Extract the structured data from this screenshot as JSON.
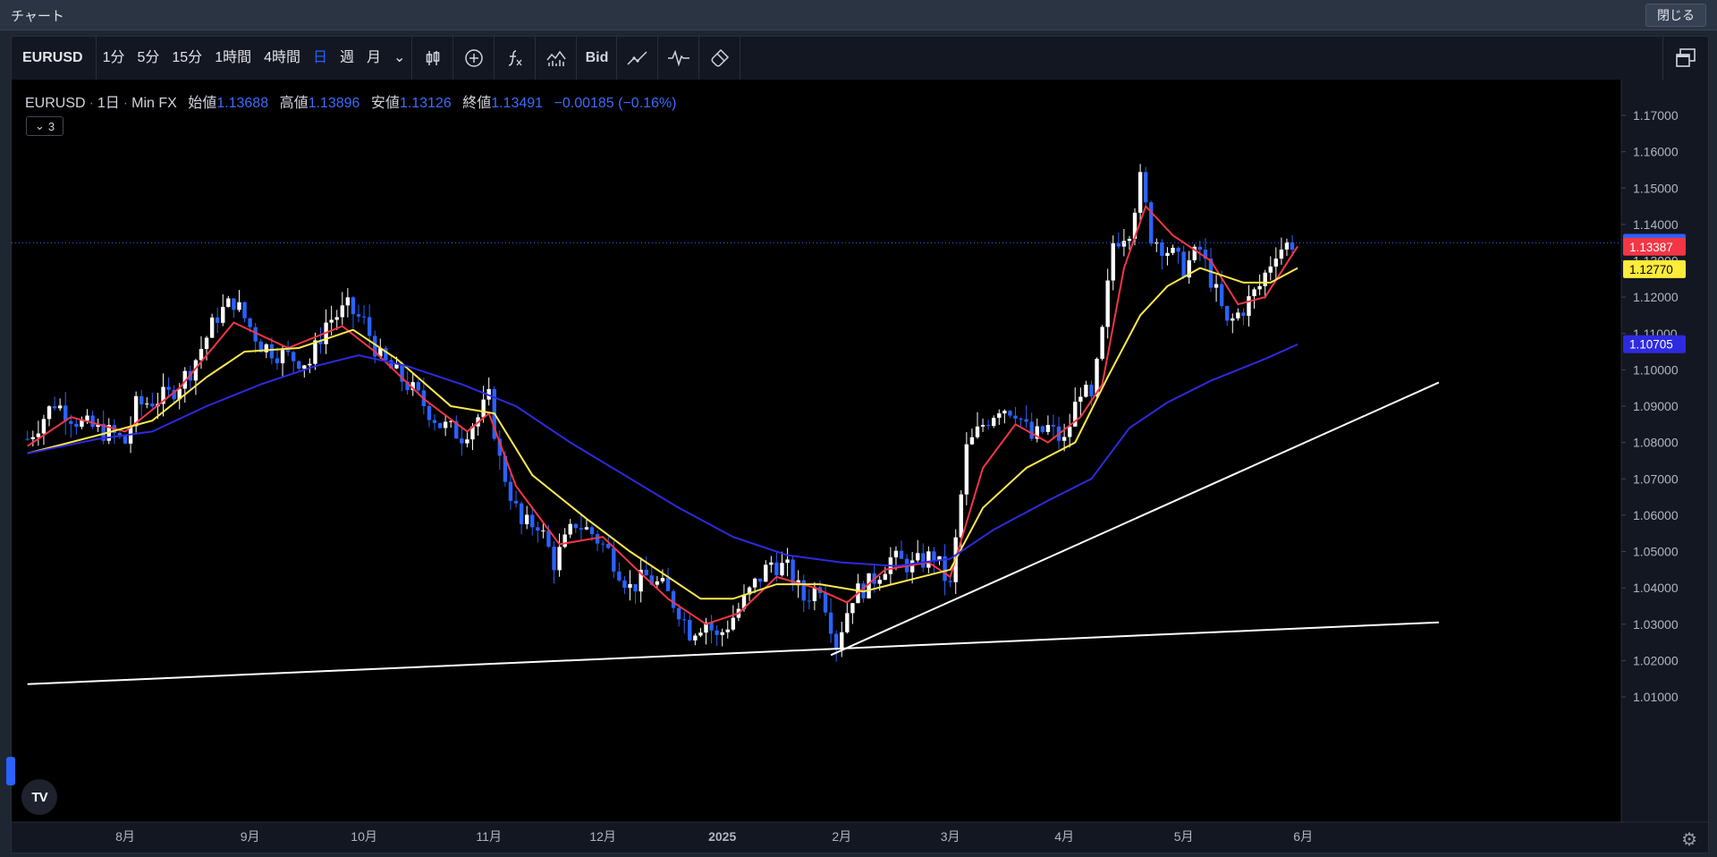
{
  "window": {
    "title": "チャート",
    "close_label": "閉じる"
  },
  "toolbar": {
    "symbol": "EURUSD",
    "timeframes": [
      "1分",
      "5分",
      "15分",
      "1時間",
      "4時間",
      "日",
      "週",
      "月"
    ],
    "active_timeframe": "日",
    "bid_label": "Bid",
    "icons": [
      "candle-style-icon",
      "add-compare-icon",
      "indicators-icon",
      "chart-templates-icon",
      "bid-label",
      "alert-line-icon",
      "replay-icon",
      "brush-icon"
    ],
    "layout_icon": "multi-window-icon"
  },
  "legend": {
    "symbol": "EURUSD",
    "interval": "1日",
    "source": "Min FX",
    "open_label": "始値",
    "open": "1.13688",
    "high_label": "高値",
    "high": "1.13896",
    "low_label": "安値",
    "low": "1.13126",
    "close_label": "終値",
    "close": "1.13491",
    "change": "−0.00185 (−0.16%)",
    "indicators_count": "3"
  },
  "colors": {
    "up": "#ffffff",
    "down": "#2962ff",
    "ma_fast": "#f23645",
    "ma_mid": "#ffe94d",
    "ma_slow": "#2e2ae0",
    "price_tag": "#2962ff"
  },
  "price_scale_labels": [
    "1.17000",
    "1.16000",
    "1.15000",
    "1.14000",
    "1.13000",
    "1.12000",
    "1.11000",
    "1.10000",
    "1.09000",
    "1.08000",
    "1.07000",
    "1.06000",
    "1.05000",
    "1.04000",
    "1.03000",
    "1.02000",
    "1.01000"
  ],
  "price_tags": [
    {
      "value": "1.13491",
      "color": "#2962ff",
      "text_color": "#ffffff"
    },
    {
      "value": "1.13387",
      "color": "#f23645",
      "text_color": "#ffffff"
    },
    {
      "value": "1.12770",
      "color": "#ffeb3b",
      "text_color": "#000000"
    },
    {
      "value": "1.10705",
      "color": "#2e2ae0",
      "text_color": "#ffffff"
    }
  ],
  "time_scale_labels": [
    "8月",
    "9月",
    "10月",
    "11月",
    "12月",
    "2025",
    "2月",
    "3月",
    "4月",
    "5月",
    "6月"
  ],
  "chart_data": {
    "type": "candlestick",
    "symbol": "EURUSD",
    "ylim": [
      1.0,
      1.175
    ],
    "month_anchors": [
      {
        "label": "8月",
        "day": 0
      },
      {
        "label": "9月",
        "day": 23
      },
      {
        "label": "10月",
        "day": 44
      },
      {
        "label": "11月",
        "day": 67
      },
      {
        "label": "12月",
        "day": 88
      },
      {
        "label": "2025",
        "day": 110
      },
      {
        "label": "2月",
        "day": 132
      },
      {
        "label": "3月",
        "day": 152
      },
      {
        "label": "4月",
        "day": 173
      },
      {
        "label": "5月",
        "day": 195
      },
      {
        "label": "6月",
        "day": 217
      }
    ],
    "close_path": [
      {
        "day": -18,
        "price": 1.081
      },
      {
        "day": -13,
        "price": 1.091
      },
      {
        "day": -8,
        "price": 1.085
      },
      {
        "day": -2,
        "price": 1.082
      },
      {
        "day": 0,
        "price": 1.08
      },
      {
        "day": 2,
        "price": 1.09
      },
      {
        "day": 8,
        "price": 1.093
      },
      {
        "day": 12,
        "price": 1.1
      },
      {
        "day": 17,
        "price": 1.115
      },
      {
        "day": 20,
        "price": 1.119
      },
      {
        "day": 25,
        "price": 1.107
      },
      {
        "day": 29,
        "price": 1.104
      },
      {
        "day": 34,
        "price": 1.102
      },
      {
        "day": 37,
        "price": 1.113
      },
      {
        "day": 41,
        "price": 1.117
      },
      {
        "day": 44,
        "price": 1.113
      },
      {
        "day": 47,
        "price": 1.103
      },
      {
        "day": 52,
        "price": 1.096
      },
      {
        "day": 58,
        "price": 1.085
      },
      {
        "day": 62,
        "price": 1.082
      },
      {
        "day": 65,
        "price": 1.087
      },
      {
        "day": 67,
        "price": 1.092
      },
      {
        "day": 69,
        "price": 1.075
      },
      {
        "day": 73,
        "price": 1.057
      },
      {
        "day": 76,
        "price": 1.058
      },
      {
        "day": 79,
        "price": 1.047
      },
      {
        "day": 83,
        "price": 1.058
      },
      {
        "day": 86,
        "price": 1.055
      },
      {
        "day": 89,
        "price": 1.05
      },
      {
        "day": 93,
        "price": 1.04
      },
      {
        "day": 96,
        "price": 1.043
      },
      {
        "day": 99,
        "price": 1.04
      },
      {
        "day": 102,
        "price": 1.034
      },
      {
        "day": 104,
        "price": 1.028
      },
      {
        "day": 107,
        "price": 1.031
      },
      {
        "day": 109,
        "price": 1.026
      },
      {
        "day": 112,
        "price": 1.032
      },
      {
        "day": 116,
        "price": 1.041
      },
      {
        "day": 119,
        "price": 1.047
      },
      {
        "day": 122,
        "price": 1.045
      },
      {
        "day": 125,
        "price": 1.037
      },
      {
        "day": 128,
        "price": 1.041
      },
      {
        "day": 131,
        "price": 1.025
      },
      {
        "day": 134,
        "price": 1.038
      },
      {
        "day": 137,
        "price": 1.041
      },
      {
        "day": 141,
        "price": 1.048
      },
      {
        "day": 145,
        "price": 1.046
      },
      {
        "day": 149,
        "price": 1.049
      },
      {
        "day": 152,
        "price": 1.04
      },
      {
        "day": 155,
        "price": 1.078
      },
      {
        "day": 158,
        "price": 1.085
      },
      {
        "day": 161,
        "price": 1.09
      },
      {
        "day": 164,
        "price": 1.089
      },
      {
        "day": 167,
        "price": 1.081
      },
      {
        "day": 170,
        "price": 1.084
      },
      {
        "day": 173,
        "price": 1.08
      },
      {
        "day": 176,
        "price": 1.095
      },
      {
        "day": 178,
        "price": 1.091
      },
      {
        "day": 180,
        "price": 1.11
      },
      {
        "day": 182,
        "price": 1.135
      },
      {
        "day": 185,
        "price": 1.139
      },
      {
        "day": 187,
        "price": 1.152
      },
      {
        "day": 189,
        "price": 1.137
      },
      {
        "day": 192,
        "price": 1.133
      },
      {
        "day": 195,
        "price": 1.128
      },
      {
        "day": 198,
        "price": 1.133
      },
      {
        "day": 201,
        "price": 1.121
      },
      {
        "day": 203,
        "price": 1.112
      },
      {
        "day": 206,
        "price": 1.117
      },
      {
        "day": 209,
        "price": 1.123
      },
      {
        "day": 212,
        "price": 1.133
      },
      {
        "day": 215,
        "price": 1.135
      }
    ],
    "moving_averages": [
      {
        "color": "#f23645",
        "points": [
          [
            -18,
            1.079
          ],
          [
            -10,
            1.087
          ],
          [
            0,
            1.083
          ],
          [
            10,
            1.095
          ],
          [
            20,
            1.113
          ],
          [
            30,
            1.106
          ],
          [
            40,
            1.112
          ],
          [
            46,
            1.105
          ],
          [
            55,
            1.092
          ],
          [
            63,
            1.083
          ],
          [
            67,
            1.088
          ],
          [
            72,
            1.068
          ],
          [
            80,
            1.052
          ],
          [
            88,
            1.054
          ],
          [
            95,
            1.044
          ],
          [
            100,
            1.037
          ],
          [
            107,
            1.03
          ],
          [
            113,
            1.033
          ],
          [
            120,
            1.043
          ],
          [
            127,
            1.04
          ],
          [
            133,
            1.036
          ],
          [
            140,
            1.045
          ],
          [
            148,
            1.047
          ],
          [
            152,
            1.043
          ],
          [
            158,
            1.073
          ],
          [
            164,
            1.085
          ],
          [
            170,
            1.08
          ],
          [
            176,
            1.087
          ],
          [
            180,
            1.096
          ],
          [
            184,
            1.128
          ],
          [
            188,
            1.145
          ],
          [
            193,
            1.137
          ],
          [
            200,
            1.13
          ],
          [
            205,
            1.118
          ],
          [
            210,
            1.12
          ],
          [
            216,
            1.134
          ]
        ]
      },
      {
        "color": "#ffe94d",
        "points": [
          [
            -18,
            1.077
          ],
          [
            -5,
            1.082
          ],
          [
            5,
            1.086
          ],
          [
            15,
            1.098
          ],
          [
            22,
            1.105
          ],
          [
            32,
            1.106
          ],
          [
            42,
            1.111
          ],
          [
            50,
            1.103
          ],
          [
            60,
            1.09
          ],
          [
            68,
            1.088
          ],
          [
            75,
            1.071
          ],
          [
            85,
            1.059
          ],
          [
            93,
            1.05
          ],
          [
            100,
            1.043
          ],
          [
            106,
            1.037
          ],
          [
            112,
            1.037
          ],
          [
            120,
            1.041
          ],
          [
            128,
            1.041
          ],
          [
            136,
            1.039
          ],
          [
            144,
            1.042
          ],
          [
            152,
            1.045
          ],
          [
            158,
            1.062
          ],
          [
            166,
            1.073
          ],
          [
            175,
            1.08
          ],
          [
            181,
            1.098
          ],
          [
            187,
            1.115
          ],
          [
            192,
            1.123
          ],
          [
            198,
            1.128
          ],
          [
            206,
            1.124
          ],
          [
            211,
            1.124
          ],
          [
            216,
            1.128
          ]
        ]
      },
      {
        "color": "#2e2ae0",
        "points": [
          [
            -18,
            1.077
          ],
          [
            -5,
            1.081
          ],
          [
            5,
            1.083
          ],
          [
            15,
            1.09
          ],
          [
            25,
            1.096
          ],
          [
            35,
            1.101
          ],
          [
            43,
            1.104
          ],
          [
            52,
            1.101
          ],
          [
            62,
            1.096
          ],
          [
            72,
            1.09
          ],
          [
            82,
            1.08
          ],
          [
            92,
            1.071
          ],
          [
            102,
            1.062
          ],
          [
            112,
            1.054
          ],
          [
            122,
            1.049
          ],
          [
            132,
            1.047
          ],
          [
            142,
            1.046
          ],
          [
            152,
            1.048
          ],
          [
            160,
            1.056
          ],
          [
            170,
            1.064
          ],
          [
            178,
            1.07
          ],
          [
            185,
            1.084
          ],
          [
            192,
            1.091
          ],
          [
            200,
            1.097
          ],
          [
            210,
            1.103
          ],
          [
            216,
            1.107
          ]
        ]
      }
    ],
    "trendlines": [
      {
        "from": [
          -18,
          1.0135
        ],
        "to": [
          242,
          1.0305
        ],
        "color": "#ffffff"
      },
      {
        "from": [
          130,
          1.0215
        ],
        "to": [
          242,
          1.0965
        ],
        "color": "#ffffff"
      }
    ],
    "last_price": 1.13491
  }
}
